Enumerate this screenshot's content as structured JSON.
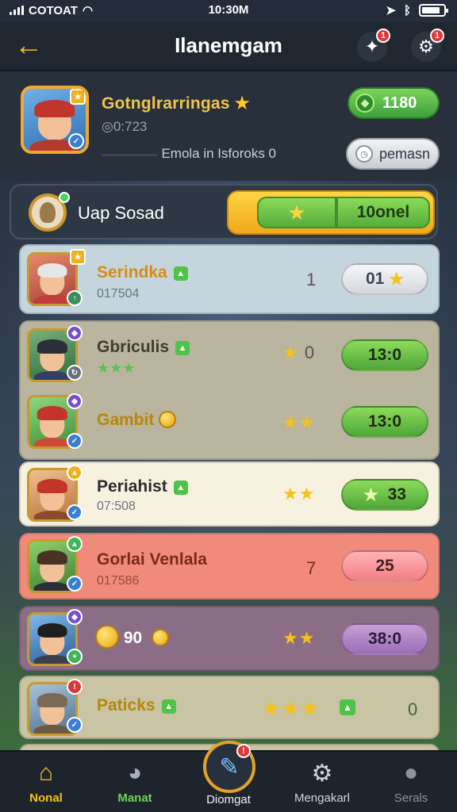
{
  "status": {
    "carrier": "COTOAT",
    "time": "10:30M"
  },
  "header": {
    "title": "Ilanemgam",
    "back_label": "←",
    "notif_count": "1",
    "settings_count": "1"
  },
  "profile": {
    "name": "Gotnglrarringas",
    "id": "0:723",
    "subtitle": "Emola in Isforoks 0",
    "gems": "1180",
    "premium_label": "pemasn"
  },
  "squad": {
    "label": "Uap Sosad",
    "progress_label": "10onel"
  },
  "rows": [
    {
      "name": "Serindka",
      "sub": "017504",
      "rank": "1",
      "value": "01",
      "stars": "★",
      "bg": "#c4d5dd",
      "name_color": "#d98c14"
    },
    {
      "name": "Gbriculis",
      "sub": "★★★",
      "rank": "0",
      "value": "13:0",
      "stars": "★",
      "bg": "#bab59e",
      "name_color": "#3c3e32"
    },
    {
      "name": "Gambit",
      "sub": "",
      "rank": "",
      "value": "13:0",
      "stars": "★★",
      "bg": "#bab59e",
      "name_color": "#b8860b"
    },
    {
      "name": "Periahist",
      "sub": "07:508",
      "rank": "",
      "value": "33",
      "stars": "★★",
      "bg": "#f7f1e0",
      "name_color": "#2c2c2c"
    },
    {
      "name": "Gorlai Venlala",
      "sub": "017586",
      "rank": "7",
      "value": "25",
      "stars": "",
      "bg": "#f08b7c",
      "name_color": "#7a2a1a"
    },
    {
      "name": "90",
      "sub": "",
      "rank": "",
      "value": "38:0",
      "stars": "★★",
      "bg": "#8c6d86",
      "name_color": "#fff"
    },
    {
      "name": "Paticks",
      "sub": "",
      "rank": "0",
      "value": "",
      "stars": "★★★",
      "bg": "#c8c4a4",
      "name_color": "#b8860b"
    }
  ],
  "nav": [
    {
      "label": "Nonal",
      "icon": "home-icon",
      "color": "#f5c21b"
    },
    {
      "label": "Manat",
      "icon": "chart-icon",
      "color": "#6fd15a"
    },
    {
      "label": "Diomgat",
      "icon": "pen-icon",
      "color": "#f0f0f0"
    },
    {
      "label": "Mengakarl",
      "icon": "gear-icon",
      "color": "#cfd5dc"
    },
    {
      "label": "Serals",
      "icon": "user-icon",
      "color": "#8b939c"
    }
  ]
}
